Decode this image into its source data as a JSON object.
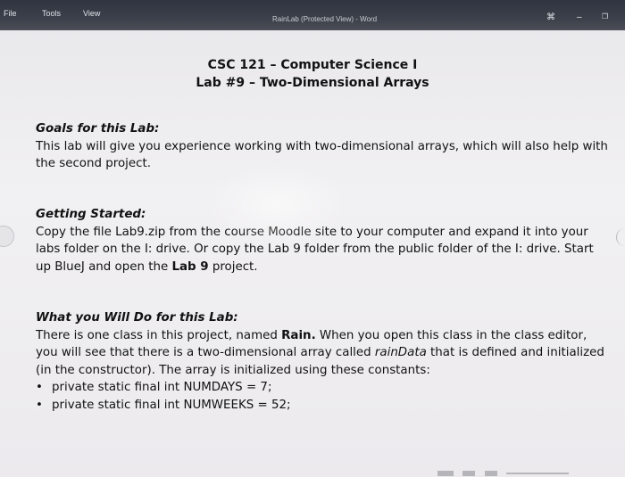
{
  "titlebar": {
    "menu": [
      "File",
      "Tools",
      "View"
    ],
    "title": "RainLab (Protected View) - Word",
    "controls": {
      "focus": "⌘",
      "minimize": "–",
      "restore": "❐"
    }
  },
  "document": {
    "course_title": "CSC 121 – Computer Science I",
    "lab_title": "Lab #9 – Two-Dimensional Arrays",
    "goals": {
      "heading": "Goals for this Lab:",
      "line1": "This lab will give you experience working with two-dimensional arrays, which will also help with",
      "line2": "the second project."
    },
    "getting_started": {
      "heading": "Getting Started:",
      "line1": "Copy the file Lab9.zip from the course Moodle site to your computer and expand it into your",
      "line2": "labs folder on the I: drive. Or copy the Lab 9 folder from the public folder of the I: drive.  Start",
      "line3_pre": "up BlueJ and open the ",
      "line3_bold": "Lab 9",
      "line3_post": " project."
    },
    "what_you_do": {
      "heading": "What you Will Do for this Lab:",
      "line1_pre": "There is one class in this project, named ",
      "line1_bold": "Rain.",
      "line1_post": "  When you open this class in the class editor,",
      "line2_pre": "you will see that there is a two-dimensional array called ",
      "line2_italic": "rainData",
      "line2_post": " that is defined and initialized",
      "line3": "(in the constructor).  The array is initialized using these constants:",
      "bullets": [
        "private static final int NUMDAYS = 7;",
        "private static final int NUMWEEKS = 52;"
      ]
    }
  }
}
